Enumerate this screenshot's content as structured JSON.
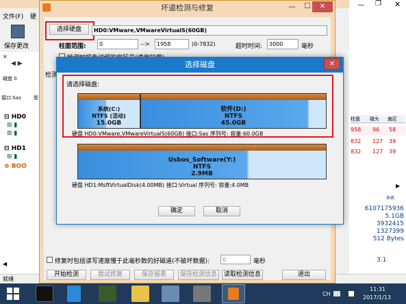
{
  "bg_window": {
    "menu_file": "文件(F)",
    "menu_disk": "硬",
    "toolbar_save": "保存更改",
    "status_text": "就绪",
    "left_disk_label": "磁盘 0",
    "left_interface": "接口:Sas",
    "left_abbrev": "型",
    "tree": [
      {
        "label": "HD0"
      },
      {
        "label": "HD1"
      },
      {
        "label": "BOO"
      }
    ],
    "right_headers": [
      "柱面",
      "磁头",
      "扇区"
    ],
    "right_rows": [
      [
        "958",
        "96",
        "58"
      ],
      [
        "832",
        "127",
        "39"
      ],
      [
        "832",
        "127",
        "39"
      ]
    ],
    "right_system": "系统",
    "right_values": [
      "6107175936",
      "5.1GB",
      "3932415",
      "1327399",
      "512 Bytes"
    ],
    "right_extra": "3.1"
  },
  "dialog": {
    "title": "坏道检测与修复",
    "select_disk_button": "选择硬盘",
    "disk_info": "HD0:VMware,VMwareVirtualS(60GB)",
    "cylinder_label": "柱面范围:",
    "cylinder_from": "0",
    "cylinder_arrow": "-->",
    "cylinder_to": "1958",
    "cylinder_range_hint": "(0-7832)",
    "timeout_label": "超时时间:",
    "timeout_value": "3000",
    "timeout_unit": "毫秒",
    "check_partial": "检测时报告详细的扇区号(速度较慢)",
    "check_label_short": "检测",
    "repair_checkbox_label": "修复时包括读写速度慢于此毫秒数的好磁道(不破坏数据):",
    "repair_ms_value": "0",
    "repair_ms_unit": "毫秒",
    "buttons": {
      "start": "开始检测",
      "try_repair": "尝试修复",
      "save_report": "保存报表",
      "save_check_info": "保存检测信息",
      "read_check_info": "读取检测信息",
      "exit": "退出"
    }
  },
  "modal": {
    "title": "选择磁盘",
    "prompt": "请选择磁盘:",
    "disk0": {
      "info": "硬盘 HD0:VMware,VMwareVirtualS(60GB)  接口:Sas  序列号:  容量:60.0GB",
      "partitions": [
        {
          "name": "系统(C:)",
          "fs": "NTFS (活动)",
          "size": "15.0GB"
        },
        {
          "name": "软件(D:)",
          "fs": "NTFS",
          "size": "45.0GB"
        }
      ]
    },
    "disk1": {
      "info": "硬盘 HD1:MsftVirtualDisk(4.00MB)  接口:Virtual  序列号:  容量:4.0MB",
      "partitions": [
        {
          "name": "Usbos_Software(Y:)",
          "fs": "NTFS",
          "size": "2.9MB"
        }
      ]
    },
    "ok": "确定",
    "cancel": "取消"
  },
  "taskbar": {
    "tray_ch": "CH",
    "time": "11:31",
    "date": "2017/1/13"
  }
}
